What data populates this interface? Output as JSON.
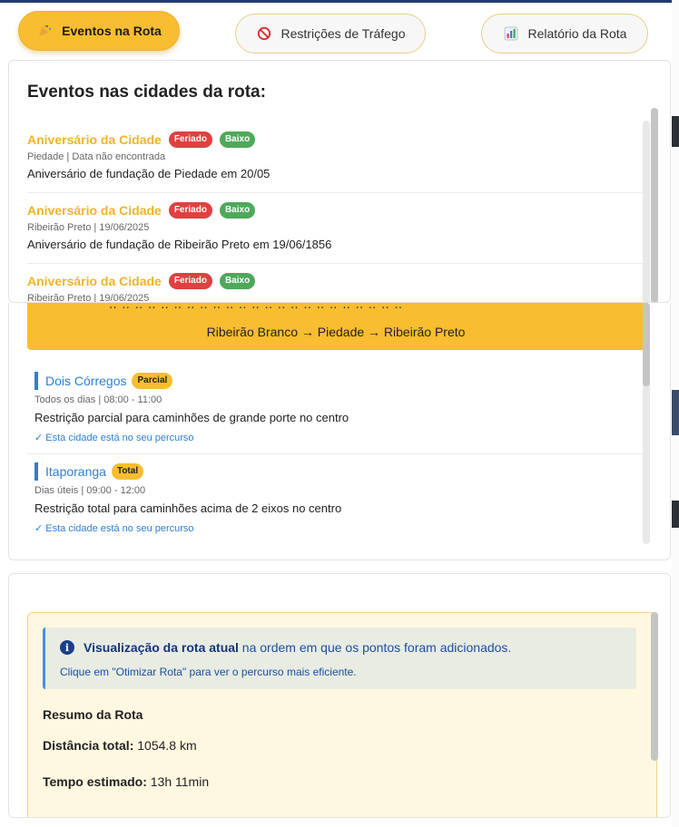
{
  "tabs": [
    {
      "label": "Eventos na Rota",
      "icon": "party-popper-icon",
      "active": true
    },
    {
      "label": "Restrições de Tráfego",
      "icon": "no-entry-icon",
      "active": false
    },
    {
      "label": "Relatório da Rota",
      "icon": "bar-chart-icon",
      "active": false
    }
  ],
  "events": {
    "title": "Eventos nas cidades da rota:",
    "items": [
      {
        "name": "Aniversário da Cidade",
        "type": "Feriado",
        "impact": "Baixo",
        "meta": "Piedade | Data não encontrada",
        "description": "Aniversário de fundação de Piedade em 20/05"
      },
      {
        "name": "Aniversário da Cidade",
        "type": "Feriado",
        "impact": "Baixo",
        "meta": "Ribeirão Preto | 19/06/2025",
        "description": "Aniversário de fundação de Ribeirão Preto em 19/06/1856"
      },
      {
        "name": "Aniversário da Cidade",
        "type": "Feriado",
        "impact": "Baixo",
        "meta": "Ribeirão Preto | 19/06/2025",
        "description": ""
      }
    ]
  },
  "restrictions": {
    "route": "Ribeirão Branco → Piedade → Ribeirão Preto",
    "items": [
      {
        "city": "Dois Córregos",
        "level": "Parcial",
        "schedule": "Todos os dias | 08:00 - 11:00",
        "description": "Restrição parcial para caminhões de grande porte no centro",
        "note": "✓ Esta cidade está no seu percurso"
      },
      {
        "city": "Itaporanga",
        "level": "Total",
        "schedule": "Dias úteis | 09:00 - 12:00",
        "description": "Restrição total para caminhões acima de 2 eixos no centro",
        "note": "✓ Esta cidade está no seu percurso"
      }
    ]
  },
  "report": {
    "info_bold": "Visualização da rota atual",
    "info_rest": " na ordem em que os pontos foram adicionados.",
    "info_sub": "Clique em \"Otimizar Rota\" para ver o percurso mais eficiente.",
    "summary_title": "Resumo da Rota",
    "distance_label": "Distância total:",
    "distance_value": "1054.8 km",
    "time_label": "Tempo estimado:",
    "time_value": "13h 11min"
  },
  "colors": {
    "accent": "#f8bd30",
    "link": "#2f7fd1",
    "danger": "#e04040",
    "success": "#4fa85a"
  }
}
